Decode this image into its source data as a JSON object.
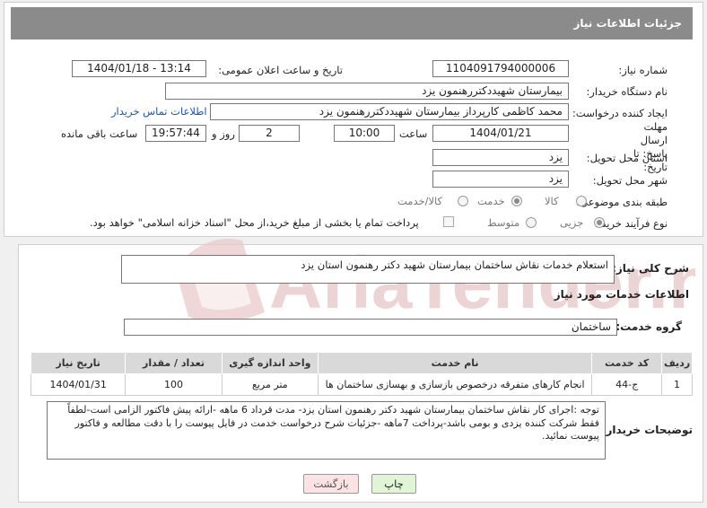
{
  "header": {
    "title": "جزئیات اطلاعات نیاز"
  },
  "fields": {
    "need_number_label": "شماره نیاز:",
    "need_number": "1104091794000006",
    "announce_label": "تاریخ و ساعت اعلان عمومی:",
    "announce_value": "1404/01/18 - 13:14",
    "buyer_org_label": "نام دستگاه خریدار:",
    "buyer_org": "بیمارستان شهیددکتررهنمون یزد",
    "requester_label": "ایجاد کننده درخواست:",
    "requester": "محمد کاظمی کارپرداز بیمارستان شهیددکتررهنمون یزد",
    "contact_link": "اطلاعات تماس خریدار",
    "deadline_label": "مهلت ارسال پاسخ: تا تاریخ:",
    "deadline_date": "1404/01/21",
    "time_label": "ساعت",
    "deadline_time": "10:00",
    "days_value": "2",
    "days_label": "روز و",
    "remaining_time": "19:57:44",
    "remaining_label": "ساعت باقی مانده",
    "province_label": "استان محل تحویل:",
    "province": "یزد",
    "city_label": "شهر محل تحویل:",
    "city": "یزد",
    "category_label": "طبقه بندی موضوعی:",
    "category_options": [
      "کالا",
      "خدمت",
      "کالا/خدمت"
    ],
    "process_label": "نوع فرآیند خرید :",
    "process_options": [
      "جزیی",
      "متوسط"
    ],
    "payment_note": "پرداخت تمام یا بخشی از مبلغ خرید،از محل \"اسناد خزانه اسلامی\" خواهد بود."
  },
  "need_summary": {
    "label": "شرح کلی نیاز:",
    "value": "استعلام خدمات نقاش ساختمان بیمارستان شهید دکتر رهنمون استان یزد"
  },
  "services": {
    "section_title": "اطلاعات خدمات مورد نیاز",
    "group_label": "گروه خدمت:",
    "group_value": "ساختمان",
    "columns": [
      "ردیف",
      "کد خدمت",
      "نام خدمت",
      "واحد اندازه گیری",
      "تعداد / مقدار",
      "تاریخ نیاز"
    ],
    "rows": [
      [
        "1",
        "ج-44",
        "انجام کارهای متفرقه درخصوص بازسازی و بهسازی ساختمان ها",
        "متر مربع",
        "100",
        "1404/01/31"
      ]
    ]
  },
  "buyer_notes": {
    "label": "توضیحات خریدار:",
    "value": "توجه :اجرای کار نقاش ساختمان بیمارستان شهید دکتر رهنمون استان یزد- مدت قرداد 6 ماهه -ارائه پیش فاکتور الزامی است-لطفاً فقط شرکت کننده یزدی و بومی باشد-پرداخت 7ماهه -جزئیات شرح درخواست خدمت در فایل پیوست را با دقت مطالعه و فاکتور پیوست نمائید."
  },
  "buttons": {
    "print": "چاپ",
    "back": "بازگشت"
  },
  "watermark_text": "AriaTender.neT",
  "colors": {
    "header": "#8b8b8b",
    "link": "#1a56b3",
    "print_button": "#dff5d6",
    "back_button": "#fbe3e3",
    "watermark": "#e7c6c6"
  }
}
